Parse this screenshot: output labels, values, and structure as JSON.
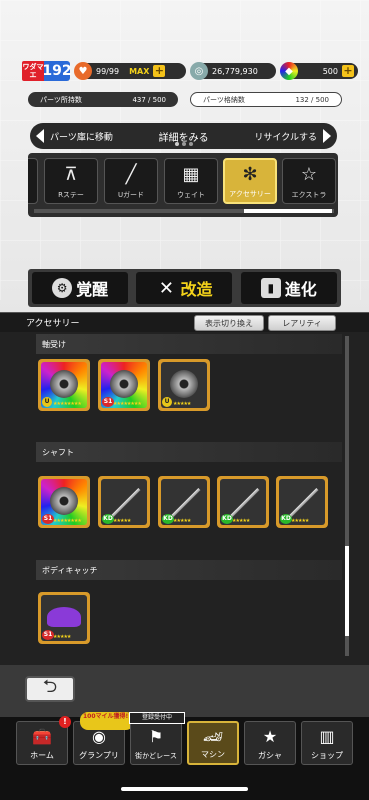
{
  "status": {
    "rank_label": "ワダマエ",
    "rank": "192",
    "energy": "99/99",
    "energy_max": "MAX",
    "money": "26,779,930",
    "gems": "500"
  },
  "capacity": {
    "held_label": "パーツ所持数",
    "held_value": "437 / 500",
    "stored_label": "パーツ格納数",
    "stored_value": "132 / 500"
  },
  "nav": {
    "left": "パーツ庫に移動",
    "title": "詳細をみる",
    "right": "リサイクルする"
  },
  "categories": [
    {
      "label": "",
      "icon": "wheel-icon"
    },
    {
      "label": "Rステー",
      "icon": "r-stay-icon"
    },
    {
      "label": "Uガード",
      "icon": "u-guard-icon"
    },
    {
      "label": "ウェイト",
      "icon": "weight-icon"
    },
    {
      "label": "アクセサリー",
      "icon": "accessory-icon",
      "selected": true
    },
    {
      "label": "エクストラ",
      "icon": "extra-icon"
    }
  ],
  "actions": {
    "awaken": "覚醒",
    "modify": "改造",
    "evolve": "進化"
  },
  "panel": {
    "title": "アクセサリー",
    "toggle": "表示切り換え",
    "rarity": "レアリティ"
  },
  "sections": [
    {
      "title": "軸受け",
      "items": [
        {
          "bg": "rainbow",
          "art": "disc",
          "grade": "U",
          "stars": "★★★★★★★★"
        },
        {
          "bg": "rainbow",
          "art": "disc",
          "grade": "S1",
          "stars": "★★★★★★★★"
        },
        {
          "bg": "grey",
          "art": "disc",
          "grade": "U",
          "stars": "★★★★★"
        }
      ]
    },
    {
      "title": "シャフト",
      "items": [
        {
          "bg": "rainbow",
          "art": "disc",
          "grade": "S1",
          "stars": "★★★★★★★★"
        },
        {
          "bg": "grey",
          "art": "shaft",
          "grade": "KD",
          "stars": "★★★★★"
        },
        {
          "bg": "grey",
          "art": "shaft",
          "grade": "KD",
          "stars": "★★★★★"
        },
        {
          "bg": "grey",
          "art": "shaft",
          "grade": "KD",
          "stars": "★★★★★"
        },
        {
          "bg": "grey",
          "art": "shaft",
          "grade": "KD",
          "stars": "★★★★★"
        }
      ]
    },
    {
      "title": "ボディキャッチ",
      "items": [
        {
          "bg": "grey",
          "art": "catch",
          "grade": "S1",
          "stars": "★★★★★"
        }
      ]
    }
  ],
  "tabs": [
    {
      "label": "ホーム",
      "icon": "home-icon",
      "badge": "!"
    },
    {
      "label": "グランプリ",
      "icon": "grandprix-icon",
      "promo": "100マイル獲得!!"
    },
    {
      "label": "街かどレース",
      "icon": "street-race-icon",
      "reg": "登録受付中"
    },
    {
      "label": "マシン",
      "icon": "machine-icon",
      "selected": true
    },
    {
      "label": "ガシャ",
      "icon": "gacha-icon"
    },
    {
      "label": "ショップ",
      "icon": "shop-icon"
    }
  ]
}
